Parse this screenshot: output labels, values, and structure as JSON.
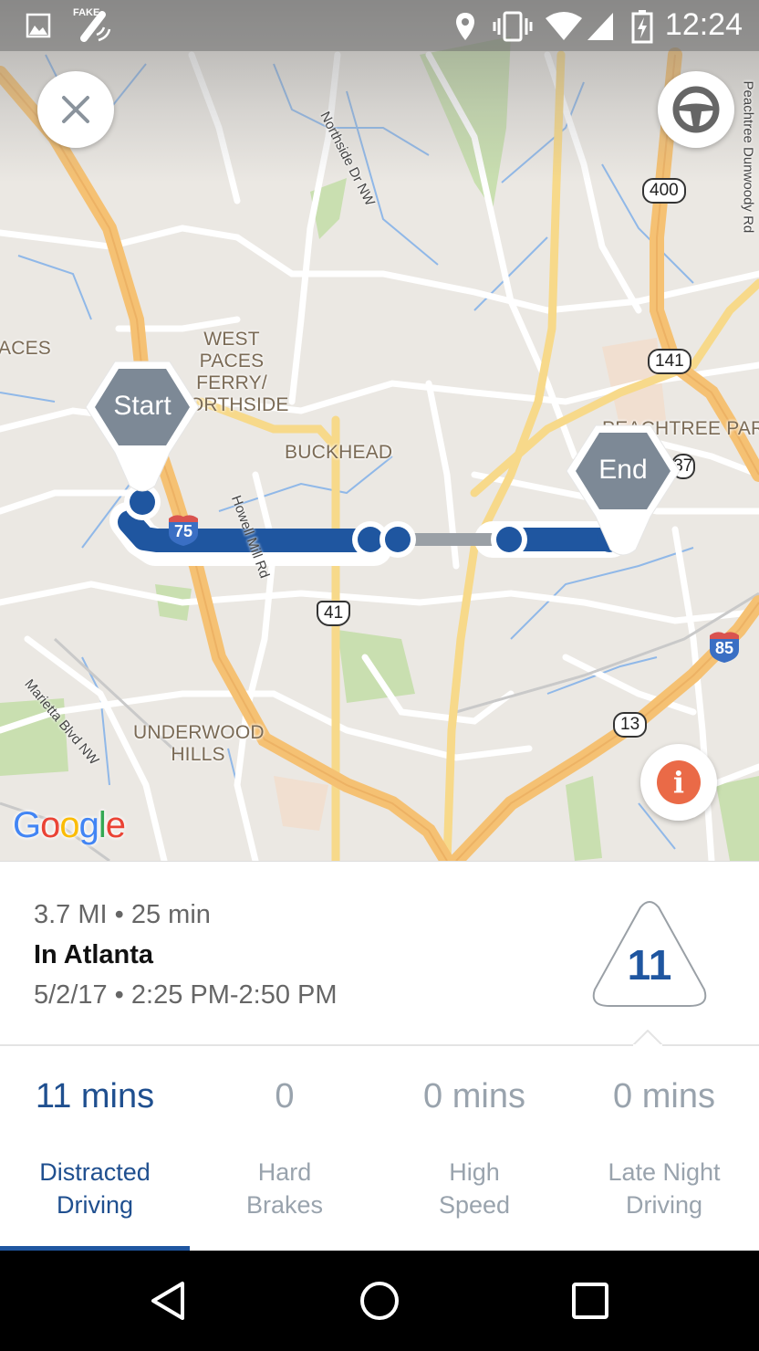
{
  "status_bar": {
    "time": "12:24",
    "left_icons": [
      "image-icon",
      "fake-gps-icon"
    ],
    "fake_gps_text": "FAKE",
    "right_icons": [
      "location-pin-icon",
      "vibrate-icon",
      "wifi-icon",
      "cell-signal-icon",
      "battery-charging-icon"
    ]
  },
  "map": {
    "attribution": "Google",
    "neighborhoods": [
      {
        "id": "west-paces",
        "text": "WEST PACES\nFERRY/\nNORTHSIDE"
      },
      {
        "id": "buckhead",
        "text": "BUCKHEAD"
      },
      {
        "id": "underwood",
        "text": "UNDERWOOD\nHILLS"
      },
      {
        "id": "peachtree-park",
        "text": "PEACHTREE PARK"
      },
      {
        "id": "paces-left",
        "text": "ACES"
      }
    ],
    "streets": [
      {
        "id": "northside",
        "text": "Northside Dr NW"
      },
      {
        "id": "howell",
        "text": "Howell Mill Rd"
      },
      {
        "id": "marietta",
        "text": "Marietta Blvd NW"
      },
      {
        "id": "peachtree-dunwoody",
        "text": "Peachtree Dunwoody Rd"
      }
    ],
    "shields": [
      {
        "id": "sr400",
        "text": "400"
      },
      {
        "id": "sr141",
        "text": "141"
      },
      {
        "id": "us41",
        "text": "41"
      },
      {
        "id": "sr13",
        "text": "13"
      },
      {
        "id": "sr237",
        "text": "237"
      }
    ],
    "interstates": [
      {
        "id": "i75",
        "text": "75"
      },
      {
        "id": "i85",
        "text": "85"
      }
    ],
    "start_label": "Start",
    "end_label": "End",
    "colors": {
      "route": "#1f56a0",
      "route_gap": "#9aa0a6",
      "pin": "#7d8996",
      "info": "#ea6a47"
    }
  },
  "buttons": {
    "close": "close-icon",
    "drive": "steering-wheel-icon",
    "info": "i"
  },
  "trip": {
    "distance_duration": "3.7 MI • 25 min",
    "location": "In Atlanta",
    "date_time": "5/2/17 • 2:25 PM-2:50 PM",
    "score": "11"
  },
  "stats": [
    {
      "value": "11 mins",
      "label_line1": "Distracted",
      "label_line2": "Driving",
      "active": true
    },
    {
      "value": "0",
      "label_line1": "Hard",
      "label_line2": "Brakes",
      "active": false
    },
    {
      "value": "0 mins",
      "label_line1": "High",
      "label_line2": "Speed",
      "active": false
    },
    {
      "value": "0 mins",
      "label_line1": "Late Night",
      "label_line2": "Driving",
      "active": false
    }
  ],
  "nav": {
    "back": "back-icon",
    "home": "home-icon",
    "recents": "recents-icon"
  }
}
